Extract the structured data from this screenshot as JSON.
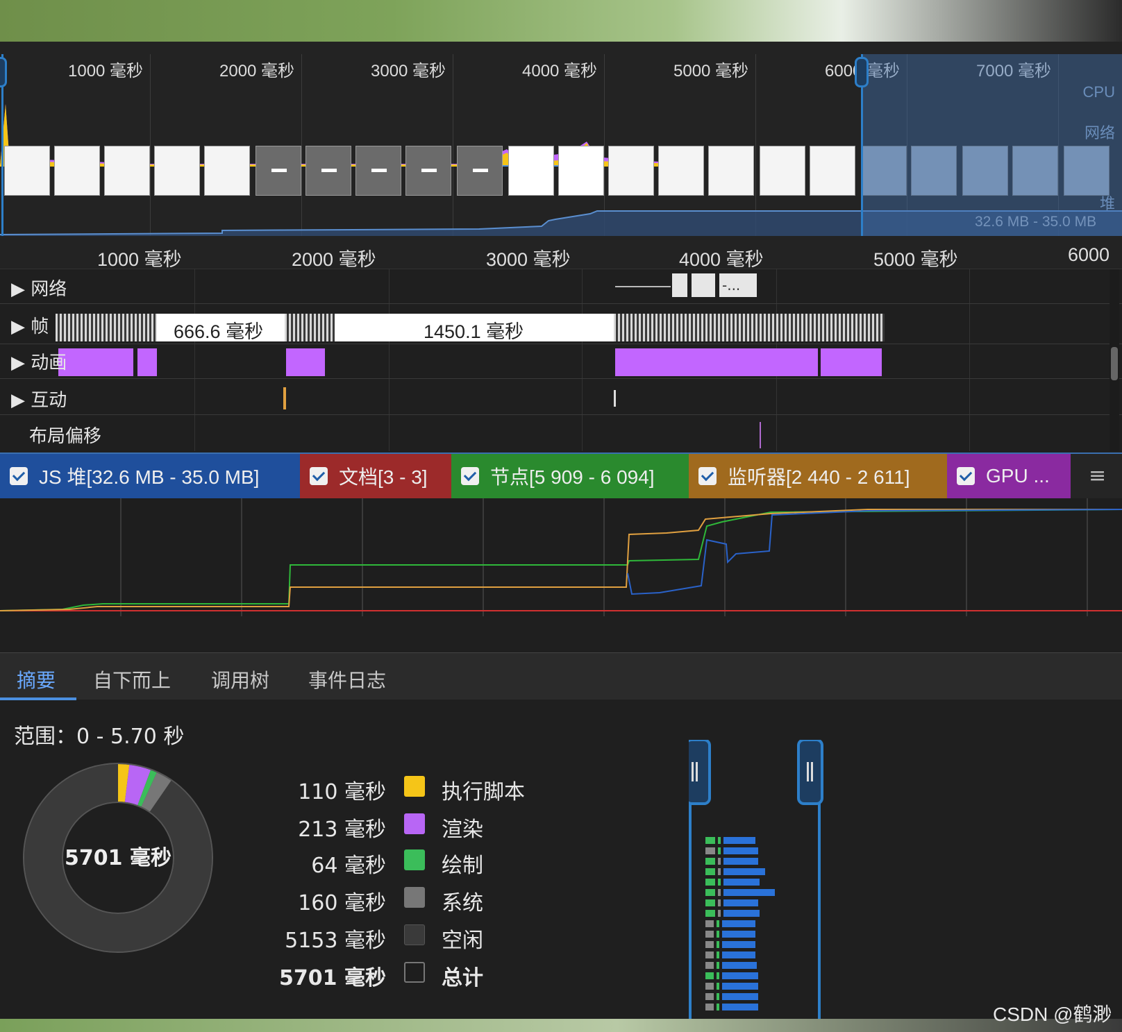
{
  "overview": {
    "ticks": [
      "1000 毫秒",
      "2000 毫秒",
      "3000 毫秒",
      "4000 毫秒",
      "5000 毫秒",
      "6000 毫秒",
      "7000 毫秒"
    ],
    "cpu_label": "CPU",
    "net_label": "网络",
    "heap_label": "堆",
    "heap_range": "32.6 MB - 35.0 MB"
  },
  "timeline": {
    "ruler": [
      "1000 毫秒",
      "2000 毫秒",
      "3000 毫秒",
      "4000 毫秒",
      "5000 毫秒",
      "6000"
    ],
    "tracks": {
      "network": "网络",
      "frames": "帧",
      "animation": "动画",
      "interaction": "互动",
      "layout_shift": "布局偏移"
    },
    "frame_durations": [
      "666.6 毫秒",
      "1450.1 毫秒"
    ],
    "network_request_label": "-..."
  },
  "memory": {
    "counters": [
      {
        "label": "JS 堆[32.6 MB - 35.0 MB]",
        "color": "#1f4f9c"
      },
      {
        "label": "文档[3 - 3]",
        "color": "#9c2a2a"
      },
      {
        "label": "节点[5 909 - 6 094]",
        "color": "#2a8a2e"
      },
      {
        "label": "监听器[2 440 - 2 611]",
        "color": "#a06a1e"
      },
      {
        "label": "GPU ...",
        "color": "#8a2aa0"
      }
    ],
    "menu_icon": "hamburger-menu-icon"
  },
  "bottom": {
    "tabs": [
      "摘要",
      "自下而上",
      "调用树",
      "事件日志"
    ],
    "active_tab": "摘要",
    "range": "范围：0 - 5.70 秒",
    "donut_total": "5701 毫秒",
    "legend": [
      {
        "value": "110 毫秒",
        "name": "执行脚本",
        "color": "#f5c518"
      },
      {
        "value": "213 毫秒",
        "name": "渲染",
        "color": "#b866f5"
      },
      {
        "value": "64 毫秒",
        "name": "绘制",
        "color": "#3bbd5a"
      },
      {
        "value": "160 毫秒",
        "name": "系统",
        "color": "#777777"
      },
      {
        "value": "5153 毫秒",
        "name": "空闲",
        "color": "#3a3a3a"
      },
      {
        "value": "5701 毫秒",
        "name": "总计",
        "color": "#1e1e1e"
      }
    ],
    "breakdown_ms": {
      "scripting": 110,
      "rendering": 213,
      "painting": 64,
      "system": 160,
      "idle": 5153
    }
  },
  "watermark": "CSDN @鹤渺"
}
